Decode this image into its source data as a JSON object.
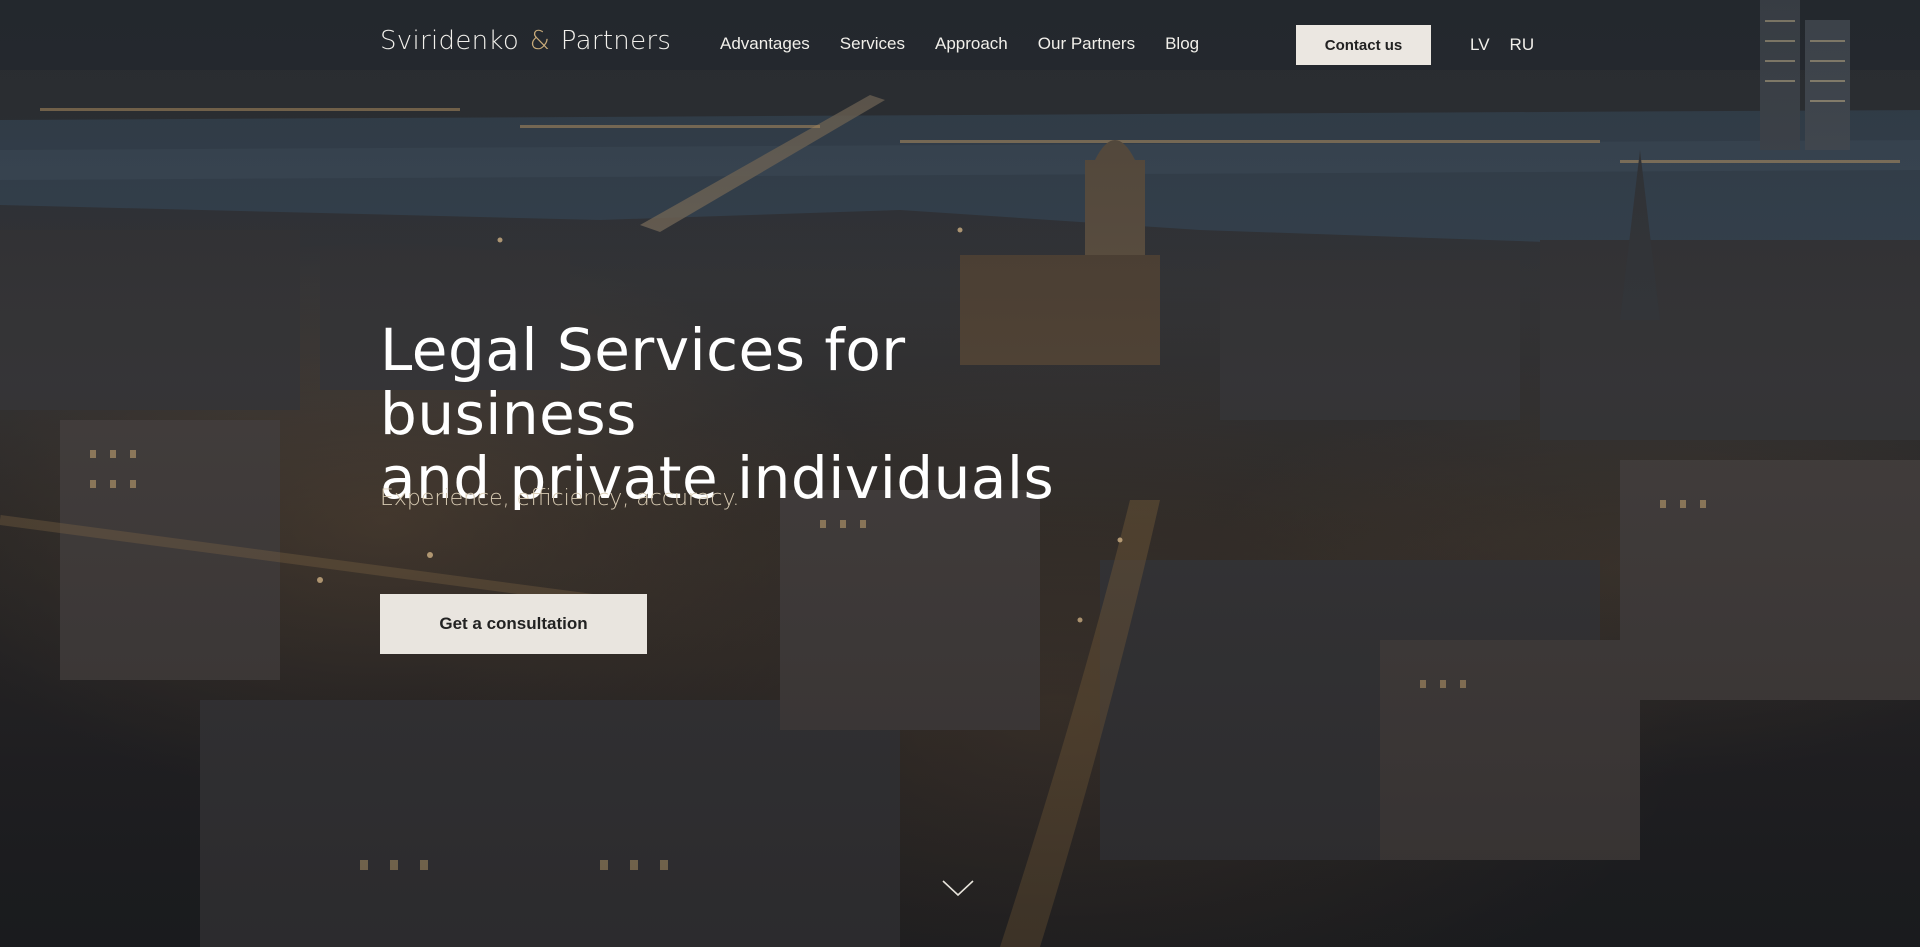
{
  "header": {
    "logo": {
      "part1": "Sviridenko",
      "amp": "&",
      "part2": "Partners"
    },
    "nav": [
      {
        "label": "Advantages"
      },
      {
        "label": "Services"
      },
      {
        "label": "Approach"
      },
      {
        "label": "Our Partners"
      },
      {
        "label": "Blog"
      }
    ],
    "contact_label": "Contact us",
    "languages": [
      {
        "label": "LV"
      },
      {
        "label": "RU"
      }
    ]
  },
  "hero": {
    "title_line1": "Legal Services for business",
    "title_line2": "and private individuals",
    "subtitle": "Experience, efficiency, accuracy.",
    "cta_label": "Get a consultation"
  },
  "icons": {
    "scroll": "chevron-down-icon"
  },
  "colors": {
    "accent": "#c9ab7a",
    "subtitle": "#d8cbb3",
    "button_bg": "#e9e5df",
    "button_text": "#222222"
  }
}
